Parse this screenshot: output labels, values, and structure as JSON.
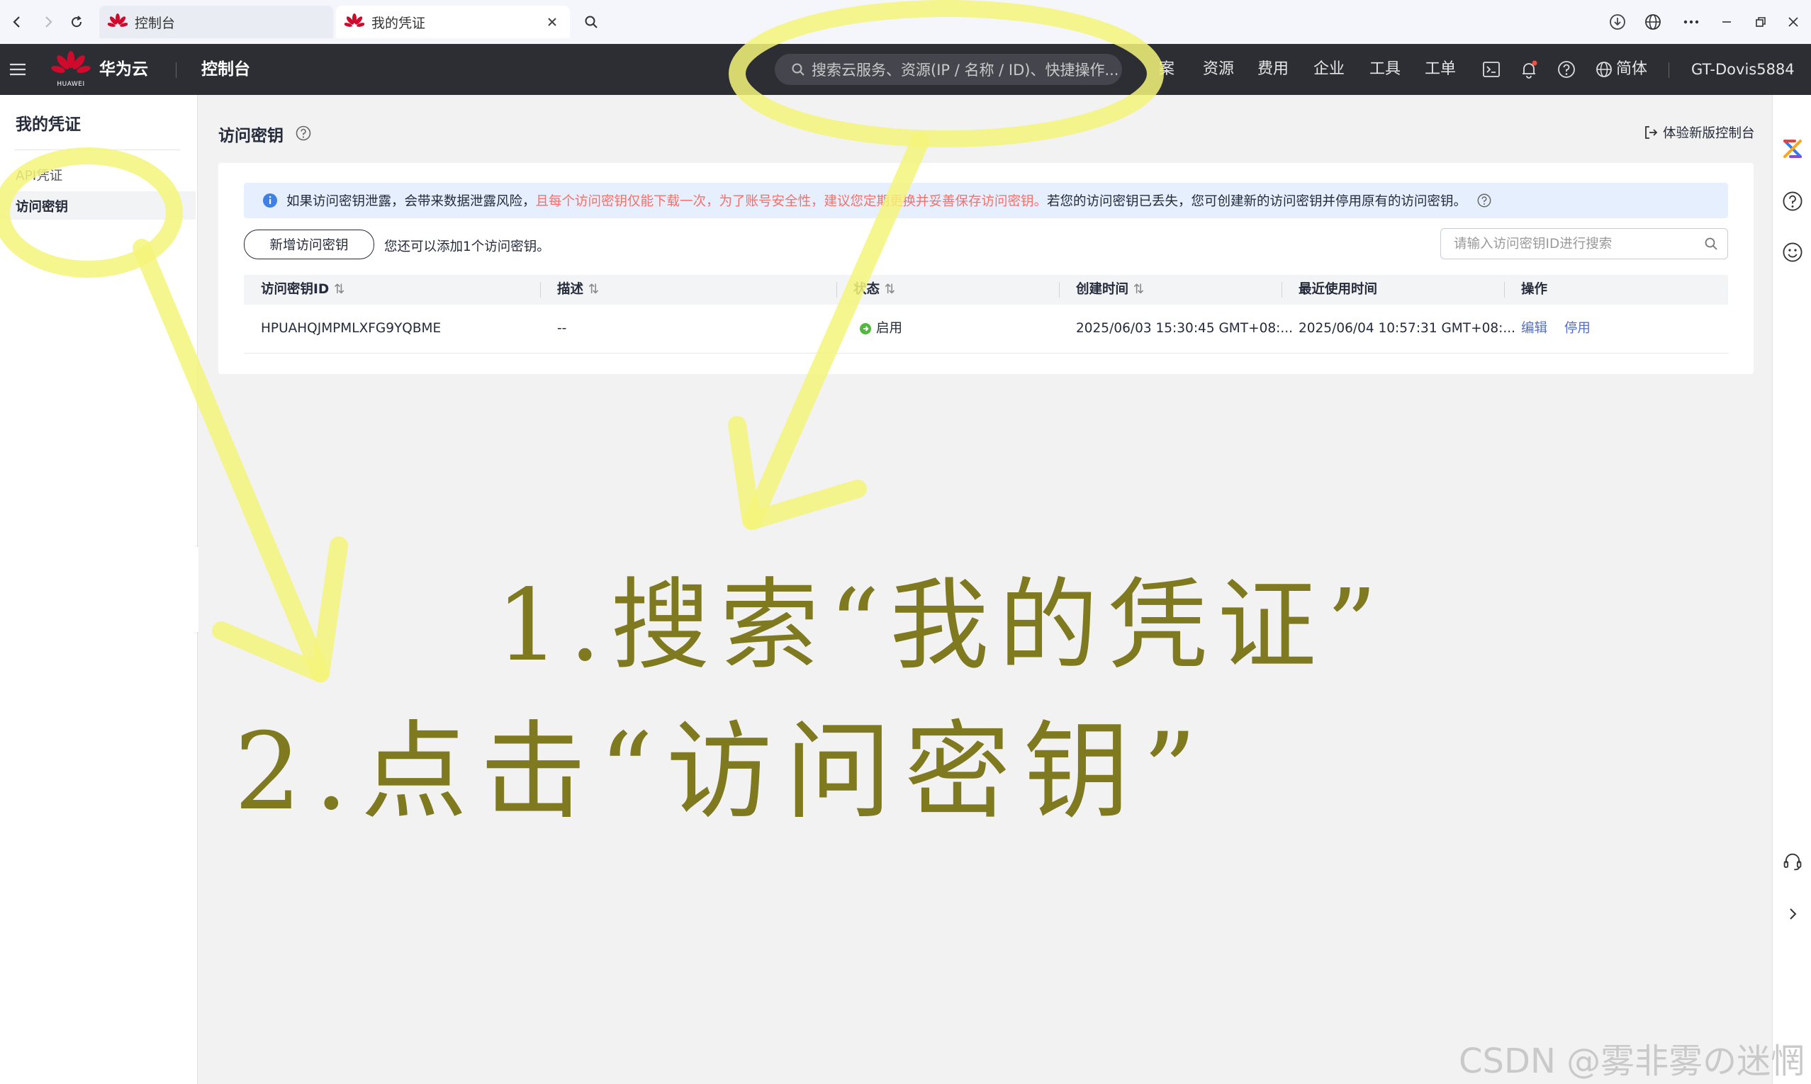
{
  "browser": {
    "tabs": [
      {
        "label": "控制台"
      },
      {
        "label": "我的凭证"
      }
    ]
  },
  "header": {
    "brand": "华为云",
    "brand_small": "HUAWEI",
    "console_label": "控制台",
    "search_placeholder": "搜索云服务、资源(IP / 名称 / ID)、快捷操作...",
    "nav_items": [
      "案",
      "资源",
      "费用",
      "企业",
      "工具",
      "工单"
    ],
    "language": "简体",
    "username": "GT-Dovis5884"
  },
  "sidebar": {
    "title": "我的凭证",
    "items": [
      {
        "label": "API凭证"
      },
      {
        "label": "访问密钥"
      }
    ]
  },
  "page": {
    "title": "访问密钥",
    "new_console_link": "体验新版控制台"
  },
  "banner": {
    "text_before": "如果访问密钥泄露，会带来数据泄露风险，",
    "text_warning": "且每个访问密钥仅能下载一次，为了账号安全性，建议您定期更换并妥善保存访问密钥。",
    "text_after": "若您的访问密钥已丢失，您可创建新的访问密钥并停用原有的访问密钥。"
  },
  "toolbar": {
    "add_button": "新增访问密钥",
    "quota_text": "您还可以添加1个访问密钥。",
    "search_placeholder": "请输入访问密钥ID进行搜索"
  },
  "table": {
    "columns": [
      "访问密钥ID",
      "描述",
      "状态",
      "创建时间",
      "最近使用时间",
      "操作"
    ],
    "rows": [
      {
        "key_id": "HPUAHQJMPMLXFG9YQBME",
        "description": "--",
        "status": "启用",
        "created": "2025/06/03 15:30:45 GMT+08:...",
        "last_used": "2025/06/04 10:57:31 GMT+08:...",
        "actions": [
          "编辑",
          "停用"
        ]
      }
    ]
  },
  "annotations": {
    "step1": "1.搜索“我的凭证”",
    "step2": "2.点击“访问密钥”"
  },
  "watermark": "CSDN @雾非雾の迷惘",
  "colors": {
    "header_bg": "#2d2e34",
    "link": "#526ecc",
    "warning_text": "#f66f6a",
    "status_ok": "#50b83c",
    "annotation_yellow": "#f5f57a",
    "annotation_text": "#7f7a1f"
  }
}
